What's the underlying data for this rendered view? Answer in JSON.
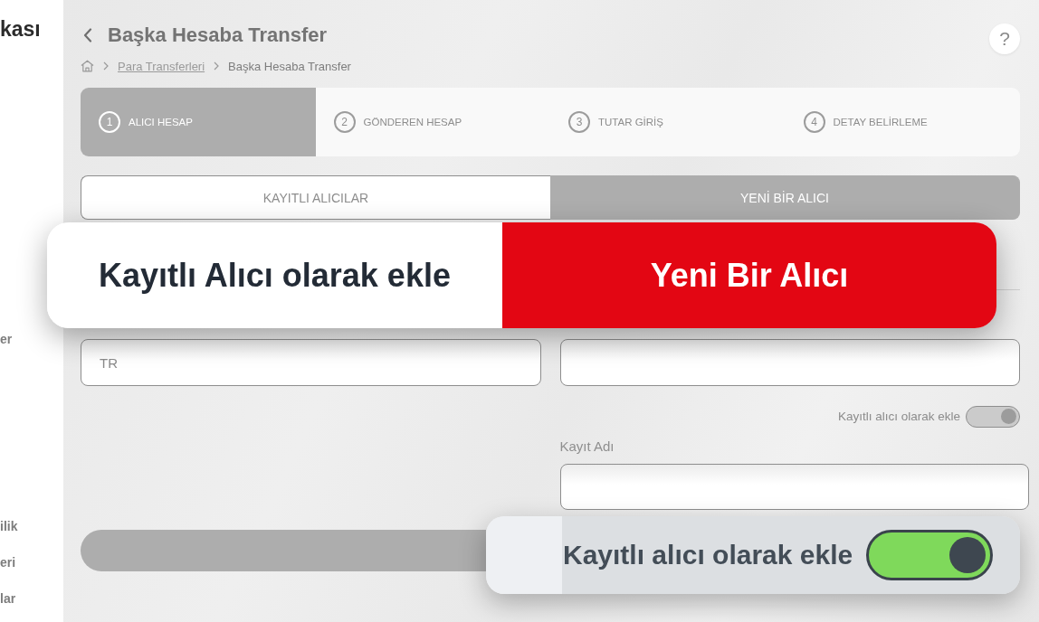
{
  "sidebar": {
    "logo_text": "kası",
    "items": [
      {
        "label": "er"
      },
      {
        "label": "ilik"
      },
      {
        "label": "eri"
      },
      {
        "label": "lar"
      }
    ]
  },
  "header": {
    "title": "Başka Hesaba Transfer",
    "help_label": "?"
  },
  "breadcrumb": [
    {
      "kind": "link",
      "label": "Para Transferleri"
    },
    {
      "kind": "current",
      "label": "Başka Hesaba Transfer"
    }
  ],
  "steps": [
    {
      "number": "1",
      "label": "ALICI HESAP",
      "selected": true
    },
    {
      "number": "2",
      "label": "GÖNDEREN HESAP",
      "selected": false
    },
    {
      "number": "3",
      "label": "TUTAR GİRİŞ",
      "selected": false
    },
    {
      "number": "4",
      "label": "DETAY BELİRLEME",
      "selected": false
    }
  ],
  "recipient_tabs": [
    {
      "label": "KAYITLI ALICILAR",
      "selected": false
    },
    {
      "label": "YENİ BİR ALICI",
      "selected": true
    }
  ],
  "form": {
    "iban_field": {
      "value": "TR"
    },
    "save_toggle": {
      "label": "Kayıtlı alıcı olarak ekle",
      "on": true
    },
    "record_name": {
      "label": "Kayıt Adı"
    }
  },
  "submit_button": {
    "disabled": true
  },
  "callouts": [
    {
      "kind": "segmented",
      "options": [
        {
          "label": "Kayıtlı Alıcı olarak ekle",
          "selected": false
        },
        {
          "label": "Yeni Bir Alıcı",
          "selected": true
        }
      ]
    },
    {
      "kind": "toggle",
      "label": "Kayıtlı alıcı olarak ekle",
      "on": true
    }
  ]
}
